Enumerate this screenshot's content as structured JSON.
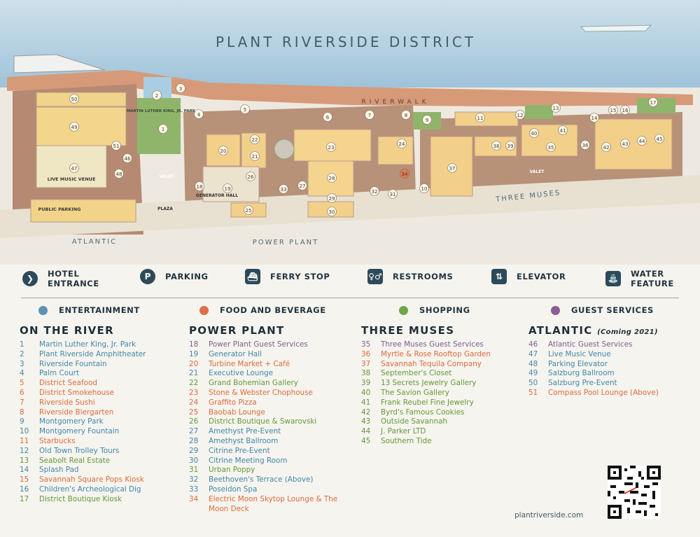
{
  "map": {
    "title": "PLANT RIVERSIDE DISTRICT",
    "street_labels": {
      "riverwalk": "RIVERWALK",
      "three_muses": "THREE MUSES",
      "atlantic": "ATLANTIC",
      "power_plant": "POWER PLANT"
    },
    "area_labels": {
      "mlk_park": "MARTIN LUTHER KING, JR. PARK",
      "live_music": "LIVE MUSIC VENUE",
      "public_parking": "PUBLIC PARKING",
      "valet": "VALET",
      "plaza": "PLAZA",
      "generator_hall": "GENERATOR HALL"
    },
    "markers": [
      "1",
      "2",
      "3",
      "4",
      "5",
      "6",
      "7",
      "8",
      "9",
      "10",
      "11",
      "12",
      "13",
      "14",
      "15",
      "16",
      "17",
      "18",
      "19",
      "20",
      "21",
      "22",
      "23",
      "24",
      "25",
      "26",
      "27",
      "28",
      "29",
      "30",
      "31",
      "32",
      "33",
      "34",
      "35",
      "36",
      "37",
      "38",
      "39",
      "40",
      "41",
      "42",
      "43",
      "44",
      "45",
      "46",
      "47",
      "48",
      "49",
      "50",
      "51"
    ]
  },
  "legend": {
    "icons": [
      {
        "icon": "hotel-entrance-icon",
        "glyph": "❯",
        "label_line1": "HOTEL",
        "label_line2": "ENTRANCE"
      },
      {
        "icon": "parking-icon",
        "glyph": "P",
        "label_line1": "PARKING",
        "label_line2": ""
      },
      {
        "icon": "ferry-stop-icon",
        "glyph": "⛴",
        "label_line1": "FERRY STOP",
        "label_line2": ""
      },
      {
        "icon": "restrooms-icon",
        "glyph": "♀♂",
        "label_line1": "RESTROOMS",
        "label_line2": ""
      },
      {
        "icon": "elevator-icon",
        "glyph": "⇅",
        "label_line1": "ELEVATOR",
        "label_line2": ""
      },
      {
        "icon": "water-feature-icon",
        "glyph": "⛲",
        "label_line1": "WATER",
        "label_line2": "FEATURE"
      }
    ],
    "categories": [
      {
        "label": "ENTERTAINMENT",
        "color": "#5b93b6"
      },
      {
        "label": "FOOD AND BEVERAGE",
        "color": "#df6f4c"
      },
      {
        "label": "SHOPPING",
        "color": "#6fa64a"
      },
      {
        "label": "GUEST SERVICES",
        "color": "#8a5f94"
      }
    ]
  },
  "sections": [
    {
      "title": "ON THE RIVER",
      "note": "",
      "items": [
        {
          "n": "1",
          "name": "Martin Luther King, Jr. Park",
          "cat": "blue"
        },
        {
          "n": "2",
          "name": "Plant Riverside Amphitheater",
          "cat": "blue"
        },
        {
          "n": "3",
          "name": "Riverside Fountain",
          "cat": "blue"
        },
        {
          "n": "4",
          "name": "Palm Court",
          "cat": "blue"
        },
        {
          "n": "5",
          "name": "District Seafood",
          "cat": "orange"
        },
        {
          "n": "6",
          "name": "District Smokehouse",
          "cat": "orange"
        },
        {
          "n": "7",
          "name": "Riverside Sushi",
          "cat": "orange"
        },
        {
          "n": "8",
          "name": "Riverside Biergarten",
          "cat": "orange"
        },
        {
          "n": "9",
          "name": "Montgomery Park",
          "cat": "blue"
        },
        {
          "n": "10",
          "name": "Montgomery Fountain",
          "cat": "blue"
        },
        {
          "n": "11",
          "name": "Starbucks",
          "cat": "orange"
        },
        {
          "n": "12",
          "name": "Old Town Trolley Tours",
          "cat": "blue"
        },
        {
          "n": "13",
          "name": "Seabolt Real Estate",
          "cat": "green"
        },
        {
          "n": "14",
          "name": "Splash Pad",
          "cat": "blue"
        },
        {
          "n": "15",
          "name": "Savannah Square Pops Kiosk",
          "cat": "orange"
        },
        {
          "n": "16",
          "name": "Children's Archeological Dig",
          "cat": "blue"
        },
        {
          "n": "17",
          "name": "District Boutique Kiosk",
          "cat": "green"
        }
      ]
    },
    {
      "title": "POWER PLANT",
      "note": "",
      "items": [
        {
          "n": "18",
          "name": "Power Plant Guest Services",
          "cat": "purple"
        },
        {
          "n": "19",
          "name": "Generator Hall",
          "cat": "blue"
        },
        {
          "n": "20",
          "name": "Turbine Market + Café",
          "cat": "orange"
        },
        {
          "n": "21",
          "name": "Executive Lounge",
          "cat": "blue"
        },
        {
          "n": "22",
          "name": "Grand Bohemian Gallery",
          "cat": "green"
        },
        {
          "n": "23",
          "name": "Stone & Webster Chophouse",
          "cat": "orange"
        },
        {
          "n": "24",
          "name": "Graffito Pizza",
          "cat": "orange"
        },
        {
          "n": "25",
          "name": "Baobab Lounge",
          "cat": "orange"
        },
        {
          "n": "26",
          "name": "District Boutique & Swarovski",
          "cat": "green"
        },
        {
          "n": "27",
          "name": "Amethyst Pre-Event",
          "cat": "blue"
        },
        {
          "n": "28",
          "name": "Amethyst Ballroom",
          "cat": "blue"
        },
        {
          "n": "29",
          "name": "Citrine Pre-Event",
          "cat": "blue"
        },
        {
          "n": "30",
          "name": "Citrine Meeting Room",
          "cat": "blue"
        },
        {
          "n": "31",
          "name": "Urban Poppy",
          "cat": "green"
        },
        {
          "n": "32",
          "name": "Beethoven's Terrace (Above)",
          "cat": "blue"
        },
        {
          "n": "33",
          "name": "Poseidon Spa",
          "cat": "blue"
        },
        {
          "n": "34",
          "name": "Electric Moon Skytop Lounge & The Moon Deck",
          "cat": "orange"
        }
      ]
    },
    {
      "title": "THREE MUSES",
      "note": "",
      "items": [
        {
          "n": "35",
          "name": "Three Muses Guest Services",
          "cat": "purple"
        },
        {
          "n": "36",
          "name": "Myrtle & Rose Rooftop Garden",
          "cat": "orange"
        },
        {
          "n": "37",
          "name": "Savannah Tequila Company",
          "cat": "orange"
        },
        {
          "n": "38",
          "name": "September's Closet",
          "cat": "green"
        },
        {
          "n": "39",
          "name": "13 Secrets Jewelry Gallery",
          "cat": "green"
        },
        {
          "n": "40",
          "name": "The Savion Gallery",
          "cat": "green"
        },
        {
          "n": "41",
          "name": "Frank Reubel Fine Jewelry",
          "cat": "green"
        },
        {
          "n": "42",
          "name": "Byrd's Famous Cookies",
          "cat": "green"
        },
        {
          "n": "43",
          "name": "Outside Savannah",
          "cat": "green"
        },
        {
          "n": "44",
          "name": "J. Parker LTD",
          "cat": "green"
        },
        {
          "n": "45",
          "name": "Southern Tide",
          "cat": "green"
        }
      ]
    },
    {
      "title": "ATLANTIC",
      "note": "(Coming 2021)",
      "items": [
        {
          "n": "46",
          "name": "Atlantic Guest Services",
          "cat": "purple"
        },
        {
          "n": "47",
          "name": "Live Music Venue",
          "cat": "blue"
        },
        {
          "n": "48",
          "name": "Parking Elevator",
          "cat": "blue"
        },
        {
          "n": "49",
          "name": "Salzburg Ballroom",
          "cat": "blue"
        },
        {
          "n": "50",
          "name": "Salzburg Pre-Event",
          "cat": "blue"
        },
        {
          "n": "51",
          "name": "Compass Pool Lounge (Above)",
          "cat": "orange"
        }
      ]
    }
  ],
  "footer": {
    "url": "plantriverside.com"
  }
}
